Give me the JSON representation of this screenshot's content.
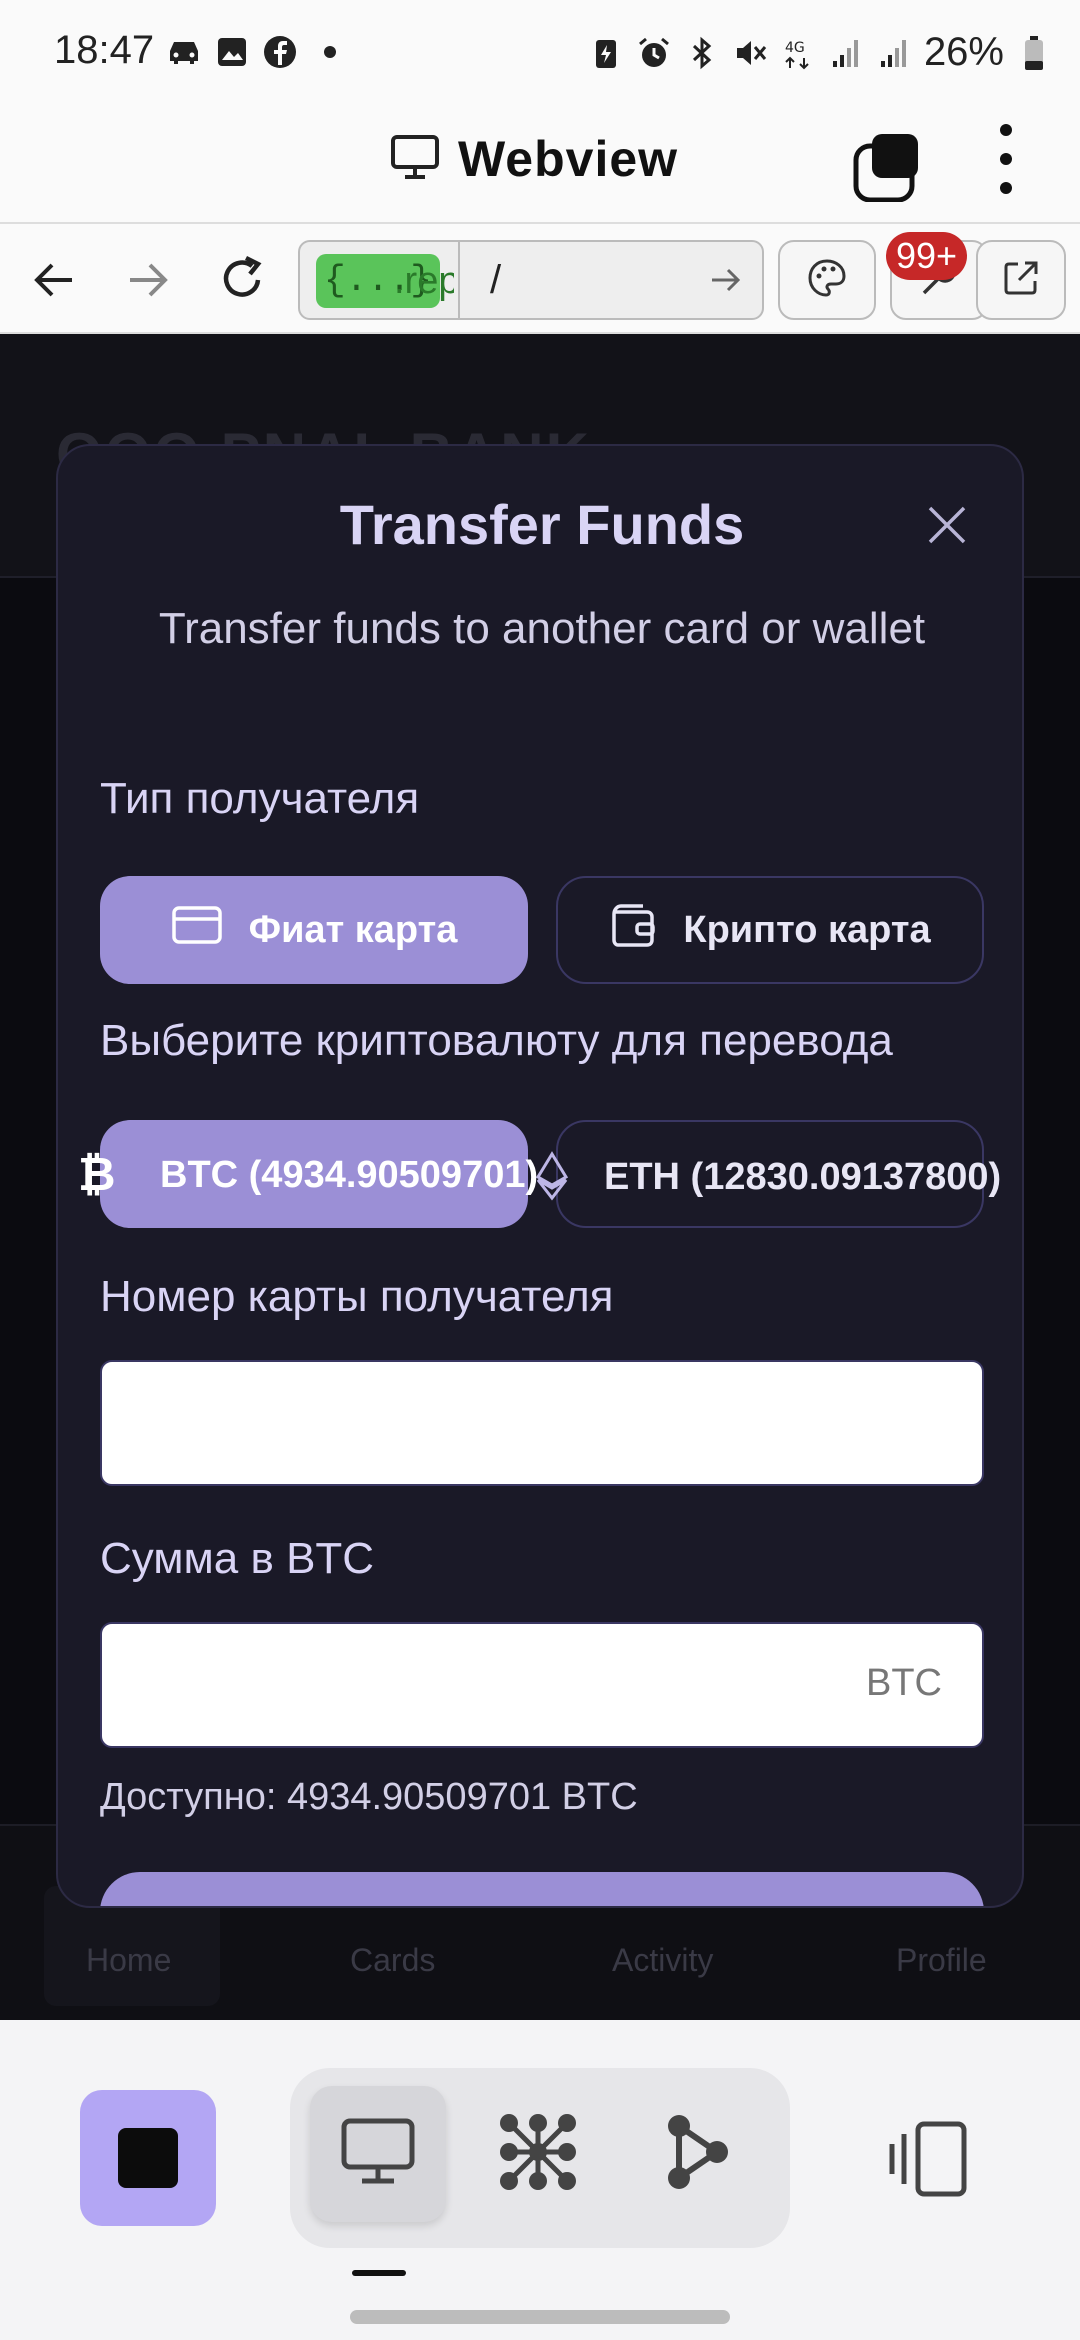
{
  "status_bar": {
    "time": "18:47",
    "battery_pct": "26%",
    "left_icons": [
      "car-icon",
      "image-icon",
      "facebook-icon",
      "dot-icon"
    ],
    "right_icons": [
      "battery-saver-icon",
      "alarm-icon",
      "bluetooth-icon",
      "mute-icon",
      "4g-icon",
      "signal-icon",
      "signal-icon",
      "battery-icon"
    ]
  },
  "app_header": {
    "title": "Webview",
    "icons": [
      "monitor-icon",
      "tabs-icon",
      "more-vert-icon"
    ]
  },
  "url_bar": {
    "badge": "{...}",
    "host": ".rep",
    "path": "/",
    "notification_count": "99+",
    "icons": [
      "back-icon",
      "forward-icon",
      "reload-icon",
      "go-arrow-icon",
      "palette-icon",
      "wrench-icon",
      "external-link-icon"
    ]
  },
  "page": {
    "brand": "OOO PNAL BANK",
    "nav": {
      "home": "Home",
      "cards": "Cards",
      "activity": "Activity",
      "profile": "Profile"
    }
  },
  "modal": {
    "title": "Transfer Funds",
    "subtitle": "Transfer funds to another card or wallet",
    "recipient_type_label": "Тип получателя",
    "recipient_types": [
      {
        "label": "Фиат карта",
        "icon": "credit-card-icon",
        "active": true
      },
      {
        "label": "Крипто карта",
        "icon": "wallet-icon",
        "active": false
      }
    ],
    "currency_label": "Выберите криптовалюту для перевода",
    "currencies": [
      {
        "label": "BTC (4934.90509701)",
        "icon": "bitcoin-icon",
        "active": true
      },
      {
        "label": "ETH (12830.09137800)",
        "icon": "ethereum-icon",
        "active": false
      }
    ],
    "card_number_label": "Номер карты получателя",
    "card_number_value": "",
    "amount_label": "Сумма в BTC",
    "amount_value": "",
    "amount_suffix": "BTC",
    "available": "Доступно: 4934.90509701 BTC"
  },
  "bottom_toolbar": {
    "icons": [
      "stop-icon",
      "monitor-icon",
      "grid-nodes-icon",
      "share-nodes-icon",
      "side-panel-icon"
    ]
  },
  "colors": {
    "accent": "#9b8fd6",
    "modal_bg": "#1a1927",
    "stop_button": "#b3a6f4"
  }
}
